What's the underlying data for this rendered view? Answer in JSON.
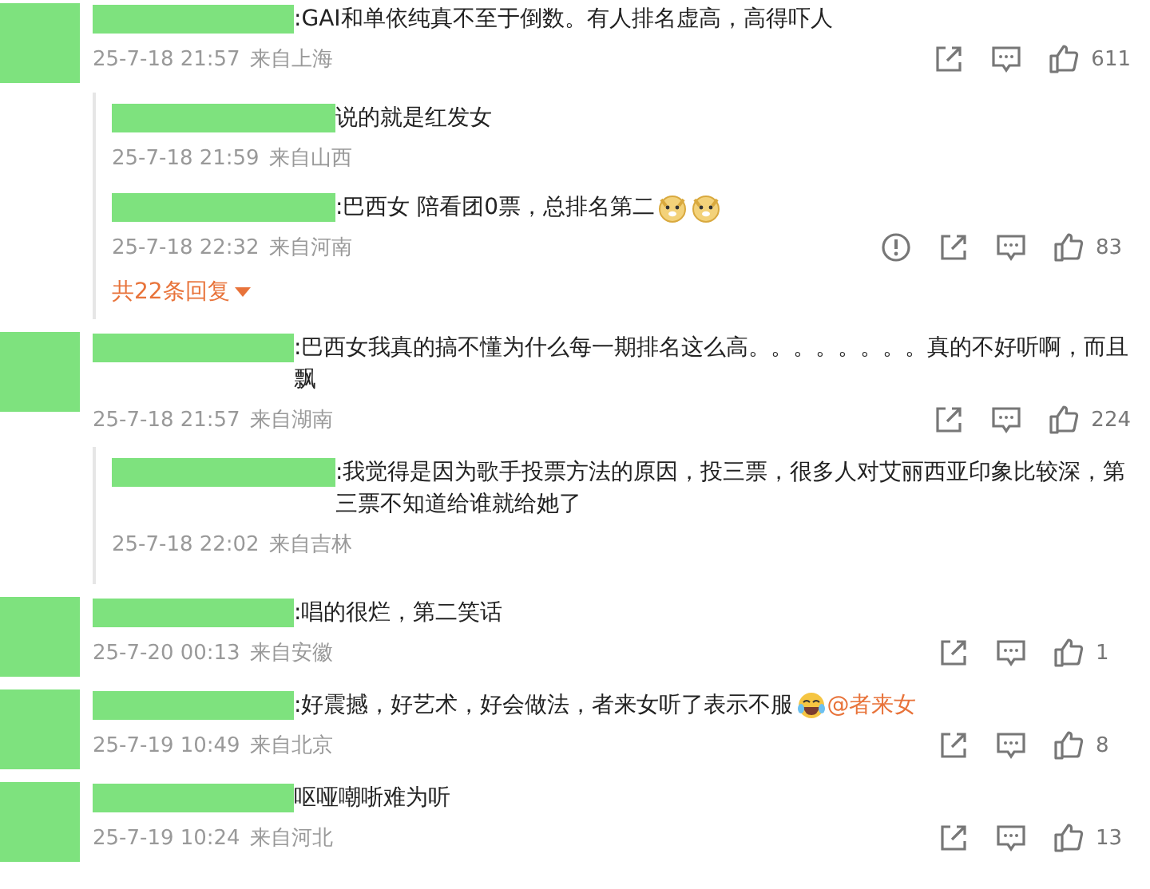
{
  "comments": [
    {
      "segments": [
        {
          "kind": "text",
          "text": ":GAI和单依纯真不至于倒数。有人排名虚高，高得吓人"
        }
      ],
      "time": "25-7-18 21:57",
      "location": "来自上海",
      "actions": [
        {
          "kind": "share"
        },
        {
          "kind": "comment"
        },
        {
          "kind": "like",
          "count": "611"
        }
      ],
      "replies": [
        {
          "segments": [
            {
              "kind": "text",
              "text": "说的就是红发女"
            }
          ],
          "time": "25-7-18 21:59",
          "location": "来自山西"
        },
        {
          "segments": [
            {
              "kind": "text",
              "text": ":巴西女 陪看团0票，总排名第二"
            },
            {
              "kind": "emoji_dog"
            },
            {
              "kind": "emoji_dog"
            }
          ],
          "time": "25-7-18 22:32",
          "location": "来自河南",
          "actions": [
            {
              "kind": "report"
            },
            {
              "kind": "share"
            },
            {
              "kind": "comment"
            },
            {
              "kind": "like",
              "count": "83"
            }
          ]
        }
      ],
      "more_replies": "共22条回复"
    },
    {
      "segments": [
        {
          "kind": "text",
          "text": ":巴西女我真的搞不懂为什么每一期排名这么高。。。。。。。。真的不好听啊，而且飘"
        }
      ],
      "time": "25-7-18 21:57",
      "location": "来自湖南",
      "actions": [
        {
          "kind": "share"
        },
        {
          "kind": "comment"
        },
        {
          "kind": "like",
          "count": "224"
        }
      ],
      "replies": [
        {
          "segments": [
            {
              "kind": "text",
              "text": ":我觉得是因为歌手投票方法的原因，投三票，很多人对艾丽西亚印象比较深，第三票不知道给谁就给她了"
            }
          ],
          "time": "25-7-18 22:02",
          "location": "来自吉林"
        }
      ]
    },
    {
      "segments": [
        {
          "kind": "text",
          "text": ":唱的很烂，第二笑话"
        }
      ],
      "time": "25-7-20 00:13",
      "location": "来自安徽",
      "actions": [
        {
          "kind": "share"
        },
        {
          "kind": "comment"
        },
        {
          "kind": "like",
          "count": "1"
        }
      ]
    },
    {
      "segments": [
        {
          "kind": "text",
          "text": ":好震撼，好艺术，好会做法，者来女听了表示不服"
        },
        {
          "kind": "emoji_laugh"
        },
        {
          "kind": "mention",
          "text": "@者来女"
        }
      ],
      "time": "25-7-19 10:49",
      "location": "来自北京",
      "actions": [
        {
          "kind": "share"
        },
        {
          "kind": "comment"
        },
        {
          "kind": "like",
          "count": "8"
        }
      ]
    },
    {
      "segments": [
        {
          "kind": "text",
          "text": "呕哑嘲哳难为听"
        }
      ],
      "time": "25-7-19 10:24",
      "location": "来自河北",
      "actions": [
        {
          "kind": "share"
        },
        {
          "kind": "comment"
        },
        {
          "kind": "like",
          "count": "13"
        }
      ]
    }
  ]
}
